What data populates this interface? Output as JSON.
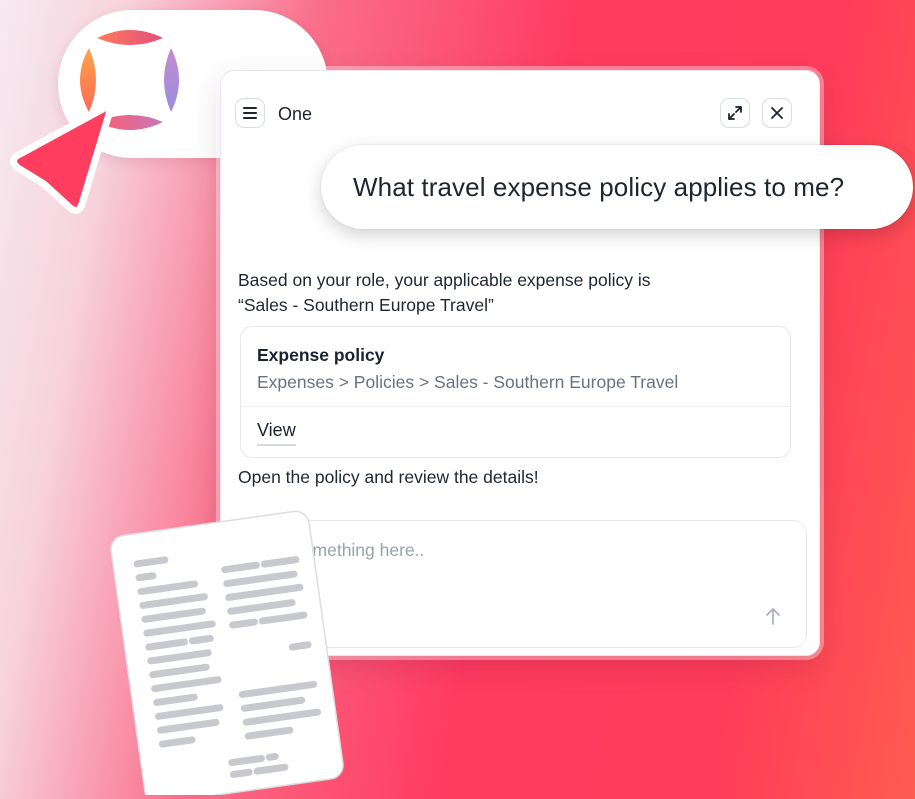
{
  "colors": {
    "accent": "#ff3d5f",
    "text": "#1f2532",
    "muted": "#6a7282"
  },
  "panel": {
    "title": "One",
    "menu_icon": "hamburger-icon",
    "expand_icon": "expand-icon",
    "close_icon": "close-icon"
  },
  "chat": {
    "question": "What travel expense policy applies to me?",
    "answer_line1": "Based on your role, your applicable expense policy is",
    "answer_line2": "“Sales - Southern Europe Travel”",
    "card": {
      "title": "Expense policy",
      "path": "Expenses > Policies > Sales - Southern Europe Travel",
      "action": "View"
    },
    "follow_up": "Open the policy and review the details!"
  },
  "composer": {
    "placeholder": "Ask something here..",
    "send_icon": "arrow-up-icon"
  }
}
